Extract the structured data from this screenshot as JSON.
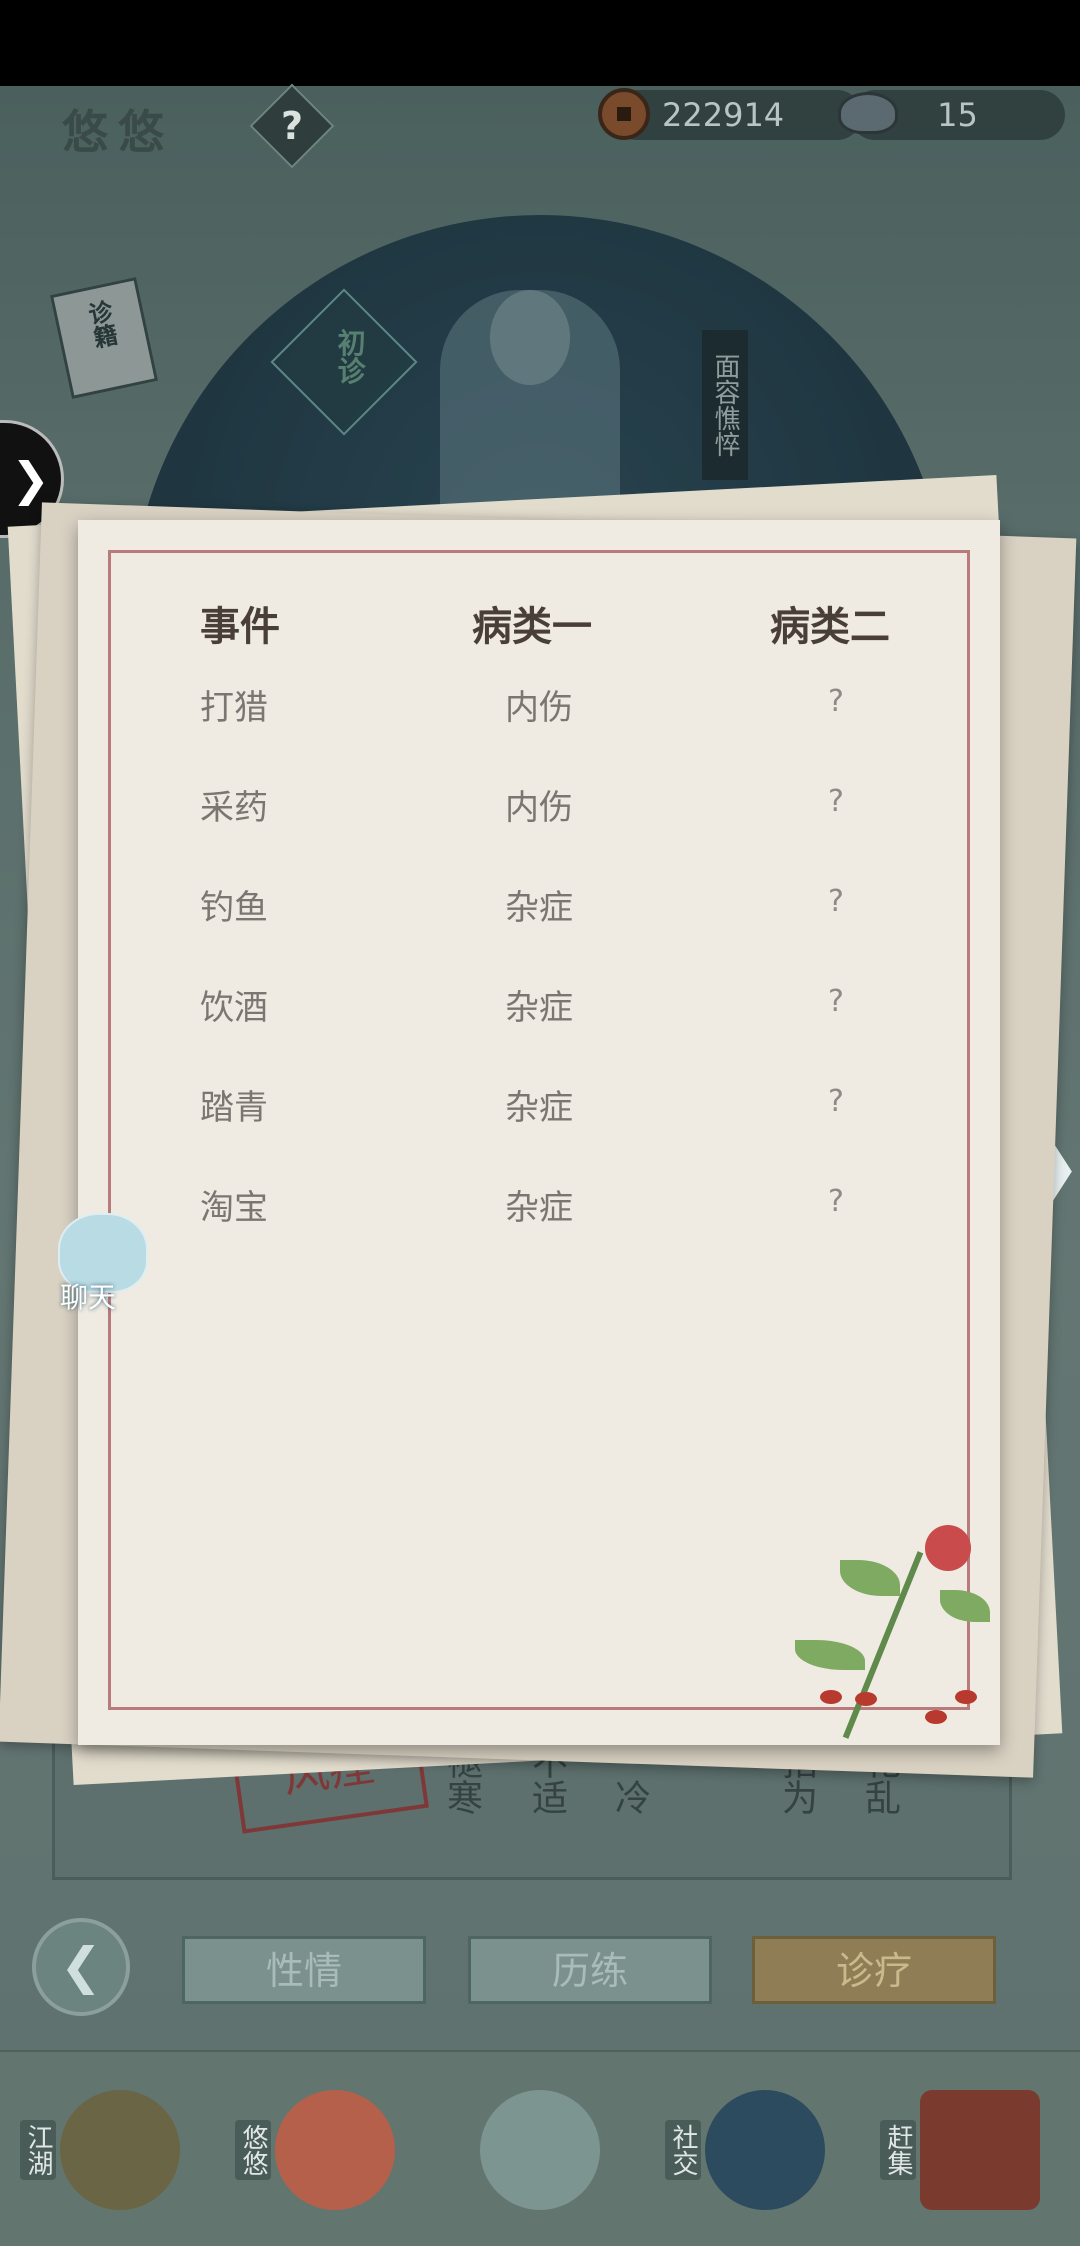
{
  "header": {
    "title": "悠悠",
    "help_label": "?",
    "coins": "222914",
    "ingots": "15"
  },
  "scene": {
    "book_label": "诊籍",
    "first_diagnosis_label": "初诊",
    "face_label": "面容憔悴",
    "stamp_label": "风痊",
    "grid_texts": [
      "褪寒",
      "不适",
      "，冷",
      "指为",
      "花乱"
    ]
  },
  "table": {
    "headers": [
      "事件",
      "病类一",
      "病类二"
    ],
    "rows": [
      [
        "打猎",
        "内伤",
        "?"
      ],
      [
        "采药",
        "内伤",
        "?"
      ],
      [
        "钓鱼",
        "杂症",
        "?"
      ],
      [
        "饮酒",
        "杂症",
        "?"
      ],
      [
        "踏青",
        "杂症",
        "?"
      ],
      [
        "淘宝",
        "杂症",
        "?"
      ]
    ]
  },
  "chat": {
    "label": "聊天"
  },
  "tabs": [
    {
      "label": "性情",
      "active": false
    },
    {
      "label": "历练",
      "active": false
    },
    {
      "label": "诊疗",
      "active": true
    }
  ],
  "nav": [
    {
      "label": "江湖"
    },
    {
      "label": "悠悠"
    },
    {
      "label": "社交"
    },
    {
      "label": "赶集"
    }
  ],
  "colors": {
    "paper": "#efebe2",
    "frame_red": "#b77b7b",
    "active_tab": "#8f7e55",
    "scene": "#6f8480"
  }
}
